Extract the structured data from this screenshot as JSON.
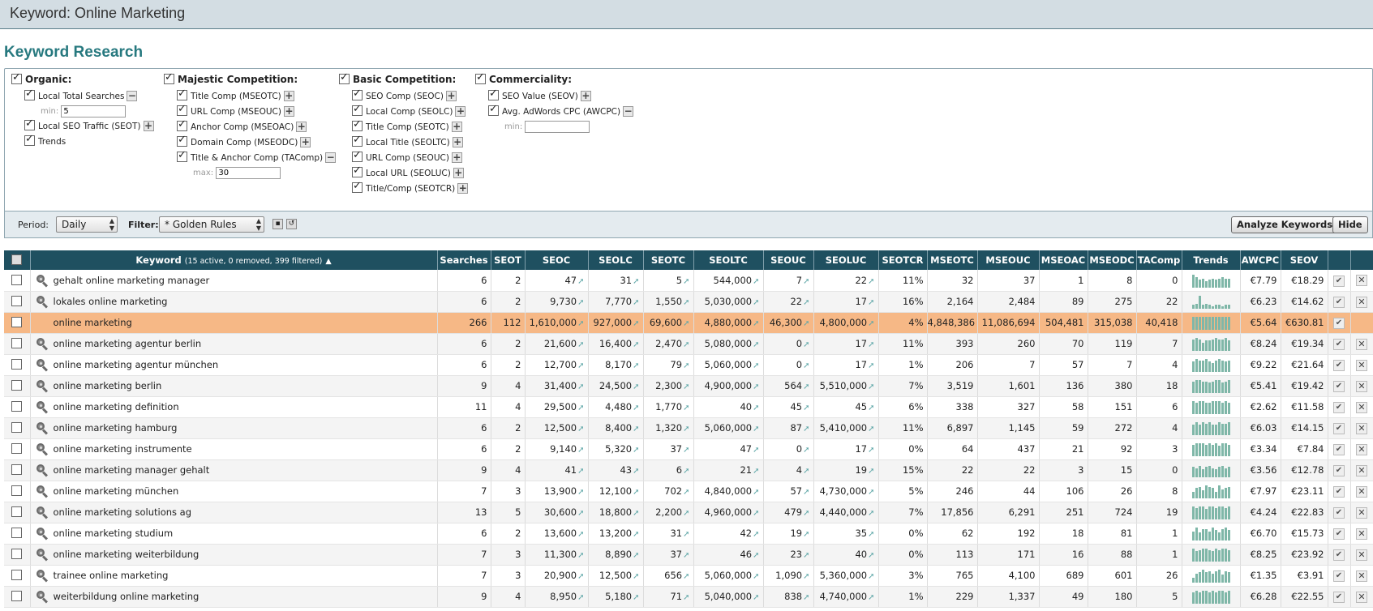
{
  "window": {
    "title": "Keyword: Online Marketing"
  },
  "section_title": "Keyword Research",
  "options": {
    "organic": {
      "label": "Organic:",
      "items": [
        {
          "label": "Local Total Searches",
          "sign": "−",
          "sub_label": "min:",
          "sub_value": "5"
        },
        {
          "label": "Local SEO Traffic (SEOT)",
          "sign": "+"
        },
        {
          "label": "Trends"
        }
      ]
    },
    "majestic": {
      "label": "Majestic Competition:",
      "items": [
        {
          "label": "Title Comp (MSEOTC)",
          "sign": "+"
        },
        {
          "label": "URL Comp (MSEOUC)",
          "sign": "+"
        },
        {
          "label": "Anchor Comp (MSEOAC)",
          "sign": "+"
        },
        {
          "label": "Domain Comp (MSEODC)",
          "sign": "+"
        },
        {
          "label": "Title & Anchor Comp (TAComp)",
          "sign": "−",
          "sub_label": "max:",
          "sub_value": "30"
        }
      ]
    },
    "basic": {
      "label": "Basic Competition:",
      "items": [
        {
          "label": "SEO Comp (SEOC)",
          "sign": "+"
        },
        {
          "label": "Local Comp (SEOLC)",
          "sign": "+"
        },
        {
          "label": "Title Comp (SEOTC)",
          "sign": "+"
        },
        {
          "label": "Local Title (SEOLTC)",
          "sign": "+"
        },
        {
          "label": "URL Comp (SEOUC)",
          "sign": "+"
        },
        {
          "label": "Local URL (SEOLUC)",
          "sign": "+"
        },
        {
          "label": "Title/Comp (SEOTCR)",
          "sign": "+"
        }
      ]
    },
    "commerciality": {
      "label": "Commerciality:",
      "items": [
        {
          "label": "SEO Value (SEOV)",
          "sign": "+"
        },
        {
          "label": "Avg. AdWords CPC (AWCPC)",
          "sign": "−",
          "sub_label": "min:",
          "sub_value": ""
        }
      ]
    }
  },
  "toolbar": {
    "period_label": "Period:",
    "period_value": "Daily",
    "filter_label": "Filter:",
    "filter_value": "* Golden Rules",
    "analyze_label": "Analyze Keywords",
    "hide_label": "Hide"
  },
  "table": {
    "keyword_header": "Keyword",
    "keyword_header_note": "(15 active, 0 removed, 399 filtered)",
    "headers": [
      "Searches",
      "SEOT",
      "SEOC",
      "SEOLC",
      "SEOTC",
      "SEOLTC",
      "SEOUC",
      "SEOLUC",
      "SEOTCR",
      "MSEOTC",
      "MSEOUC",
      "MSEOAC",
      "MSEODC",
      "TAComp",
      "Trends",
      "AWCPC",
      "SEOV"
    ],
    "rows": [
      {
        "kw": "gehalt online marketing manager",
        "v": [
          "6",
          "2",
          "47",
          "31",
          "5",
          "544,000",
          "7",
          "22",
          "11%",
          "32",
          "37",
          "1",
          "8",
          "0",
          "",
          "€7.79",
          "€18.29"
        ],
        "t": [
          10,
          8,
          6,
          7,
          5,
          6,
          7,
          6,
          7,
          8,
          7,
          7
        ]
      },
      {
        "kw": "lokales online marketing",
        "v": [
          "6",
          "2",
          "9,730",
          "7,770",
          "1,550",
          "5,030,000",
          "22",
          "17",
          "16%",
          "2,164",
          "2,484",
          "89",
          "275",
          "22",
          "",
          "€6.23",
          "€14.62"
        ],
        "t": [
          3,
          4,
          10,
          3,
          4,
          3,
          2,
          3,
          3,
          2,
          3,
          3
        ]
      },
      {
        "kw": "online marketing",
        "v": [
          "266",
          "112",
          "1,610,000",
          "927,000",
          "69,600",
          "4,880,000",
          "46,300",
          "4,800,000",
          "4%",
          "4,848,386",
          "11,086,694",
          "504,481",
          "315,038",
          "40,418",
          "",
          "€5.64",
          "€630.81"
        ],
        "t": [
          10,
          10,
          10,
          10,
          10,
          10,
          10,
          10,
          10,
          10,
          10,
          10
        ],
        "hl": true
      },
      {
        "kw": "online marketing agentur berlin",
        "v": [
          "6",
          "2",
          "21,600",
          "16,400",
          "2,470",
          "5,080,000",
          "0",
          "17",
          "11%",
          "393",
          "260",
          "70",
          "119",
          "7",
          "",
          "€8.24",
          "€19.34"
        ],
        "t": [
          9,
          10,
          9,
          6,
          8,
          8,
          9,
          10,
          9,
          9,
          10,
          8
        ]
      },
      {
        "kw": "online marketing agentur münchen",
        "v": [
          "6",
          "2",
          "12,700",
          "8,170",
          "79",
          "5,060,000",
          "0",
          "17",
          "1%",
          "206",
          "7",
          "57",
          "7",
          "4",
          "",
          "€9.22",
          "€21.64"
        ],
        "t": [
          8,
          10,
          9,
          9,
          10,
          8,
          7,
          9,
          10,
          9,
          8,
          9
        ]
      },
      {
        "kw": "online marketing berlin",
        "v": [
          "9",
          "4",
          "31,400",
          "24,500",
          "2,300",
          "4,900,000",
          "564",
          "5,510,000",
          "7%",
          "3,519",
          "1,601",
          "136",
          "380",
          "18",
          "",
          "€5.41",
          "€19.42"
        ],
        "t": [
          9,
          10,
          10,
          9,
          9,
          8,
          9,
          10,
          10,
          8,
          9,
          10
        ]
      },
      {
        "kw": "online marketing definition",
        "v": [
          "11",
          "4",
          "29,500",
          "4,480",
          "1,770",
          "40",
          "45",
          "45",
          "6%",
          "338",
          "327",
          "58",
          "151",
          "6",
          "",
          "€2.62",
          "€11.58"
        ],
        "t": [
          10,
          9,
          10,
          10,
          9,
          9,
          10,
          10,
          10,
          9,
          10,
          9
        ]
      },
      {
        "kw": "online marketing hamburg",
        "v": [
          "6",
          "2",
          "12,500",
          "8,400",
          "1,320",
          "5,060,000",
          "87",
          "5,410,000",
          "11%",
          "6,897",
          "1,145",
          "59",
          "272",
          "4",
          "",
          "€6.03",
          "€14.15"
        ],
        "t": [
          8,
          10,
          8,
          10,
          9,
          10,
          8,
          8,
          10,
          9,
          9,
          10
        ]
      },
      {
        "kw": "online marketing instrumente",
        "v": [
          "6",
          "2",
          "9,140",
          "5,320",
          "37",
          "47",
          "0",
          "17",
          "0%",
          "64",
          "437",
          "21",
          "92",
          "3",
          "",
          "€3.34",
          "€7.84"
        ],
        "t": [
          9,
          10,
          10,
          10,
          9,
          10,
          9,
          10,
          8,
          10,
          10,
          9
        ]
      },
      {
        "kw": "online marketing manager gehalt",
        "v": [
          "9",
          "4",
          "41",
          "43",
          "6",
          "21",
          "4",
          "19",
          "15%",
          "22",
          "22",
          "3",
          "15",
          "0",
          "",
          "€3.56",
          "€12.78"
        ],
        "t": [
          8,
          7,
          9,
          6,
          8,
          9,
          7,
          6,
          8,
          9,
          7,
          8
        ]
      },
      {
        "kw": "online marketing münchen",
        "v": [
          "7",
          "3",
          "13,900",
          "12,100",
          "702",
          "4,840,000",
          "57",
          "4,730,000",
          "5%",
          "246",
          "44",
          "106",
          "26",
          "8",
          "",
          "€7.97",
          "€23.11"
        ],
        "t": [
          5,
          8,
          9,
          6,
          10,
          9,
          8,
          5,
          10,
          7,
          8,
          9
        ]
      },
      {
        "kw": "online marketing solutions ag",
        "v": [
          "13",
          "5",
          "30,600",
          "18,800",
          "2,200",
          "4,960,000",
          "479",
          "4,440,000",
          "7%",
          "17,856",
          "6,291",
          "251",
          "724",
          "19",
          "",
          "€4.24",
          "€22.83"
        ],
        "t": [
          10,
          9,
          10,
          10,
          8,
          10,
          10,
          9,
          10,
          10,
          9,
          10
        ]
      },
      {
        "kw": "online marketing studium",
        "v": [
          "6",
          "2",
          "13,600",
          "13,200",
          "31",
          "42",
          "19",
          "35",
          "0%",
          "62",
          "192",
          "18",
          "81",
          "1",
          "",
          "€6.70",
          "€15.73"
        ],
        "t": [
          7,
          10,
          6,
          9,
          9,
          7,
          10,
          8,
          6,
          9,
          10,
          8
        ]
      },
      {
        "kw": "online marketing weiterbildung",
        "v": [
          "7",
          "3",
          "11,300",
          "8,890",
          "37",
          "46",
          "23",
          "40",
          "0%",
          "113",
          "171",
          "16",
          "88",
          "1",
          "",
          "€8.25",
          "€23.92"
        ],
        "t": [
          10,
          8,
          9,
          10,
          10,
          9,
          8,
          10,
          9,
          10,
          10,
          9
        ]
      },
      {
        "kw": "trainee online marketing",
        "v": [
          "7",
          "3",
          "20,900",
          "12,500",
          "656",
          "5,060,000",
          "1,090",
          "5,360,000",
          "3%",
          "765",
          "4,100",
          "689",
          "601",
          "26",
          "",
          "€1.35",
          "€3.91"
        ],
        "t": [
          4,
          7,
          8,
          10,
          8,
          9,
          7,
          9,
          10,
          6,
          9,
          8
        ]
      },
      {
        "kw": "weiterbildung online marketing",
        "v": [
          "9",
          "4",
          "8,950",
          "5,180",
          "71",
          "5,040,000",
          "838",
          "4,740,000",
          "1%",
          "229",
          "1,337",
          "49",
          "180",
          "5",
          "",
          "€6.28",
          "€22.55"
        ],
        "t": [
          9,
          10,
          9,
          10,
          10,
          9,
          10,
          9,
          10,
          10,
          9,
          10
        ]
      }
    ]
  },
  "colors": {
    "accent": "#27797f",
    "header_bg": "#1f5060",
    "highlight": "#f6b886"
  }
}
